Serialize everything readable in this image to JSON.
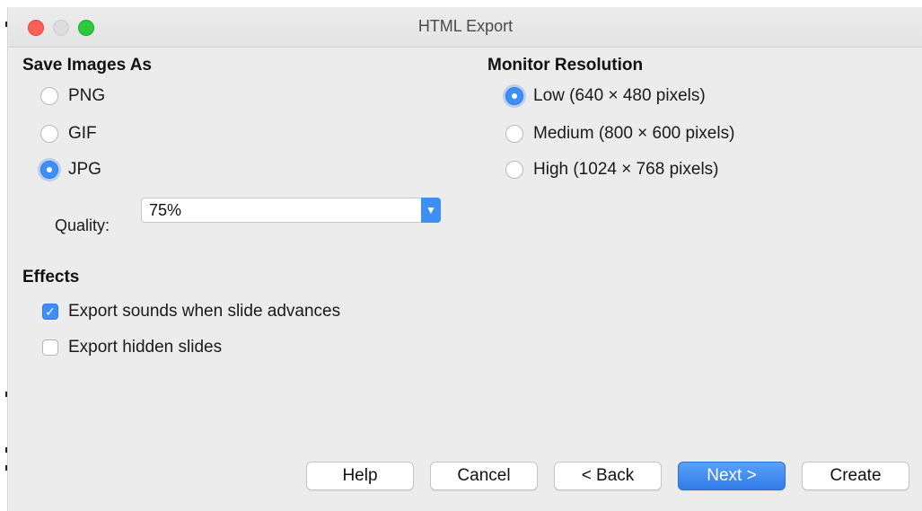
{
  "window": {
    "title": "HTML Export"
  },
  "save_images": {
    "title": "Save Images As",
    "options": [
      {
        "label": "PNG",
        "selected": false
      },
      {
        "label": "GIF",
        "selected": false
      },
      {
        "label": "JPG",
        "selected": true
      }
    ],
    "quality_label": "Quality:",
    "quality_value": "75%"
  },
  "monitor_resolution": {
    "title": "Monitor Resolution",
    "options": [
      {
        "label": "Low (640 × 480 pixels)",
        "selected": true
      },
      {
        "label": "Medium (800 × 600 pixels)",
        "selected": false
      },
      {
        "label": "High (1024 × 768 pixels)",
        "selected": false
      }
    ]
  },
  "effects": {
    "title": "Effects",
    "options": [
      {
        "label": "Export sounds when slide advances",
        "checked": true
      },
      {
        "label": "Export hidden slides",
        "checked": false
      }
    ]
  },
  "buttons": {
    "help": "Help",
    "cancel": "Cancel",
    "back": "< Back",
    "next": "Next >",
    "create": "Create"
  },
  "colors": {
    "accent": "#3d8ef5",
    "window_bg": "#ececec",
    "close": "#ff5f57",
    "zoom": "#2bc840"
  }
}
